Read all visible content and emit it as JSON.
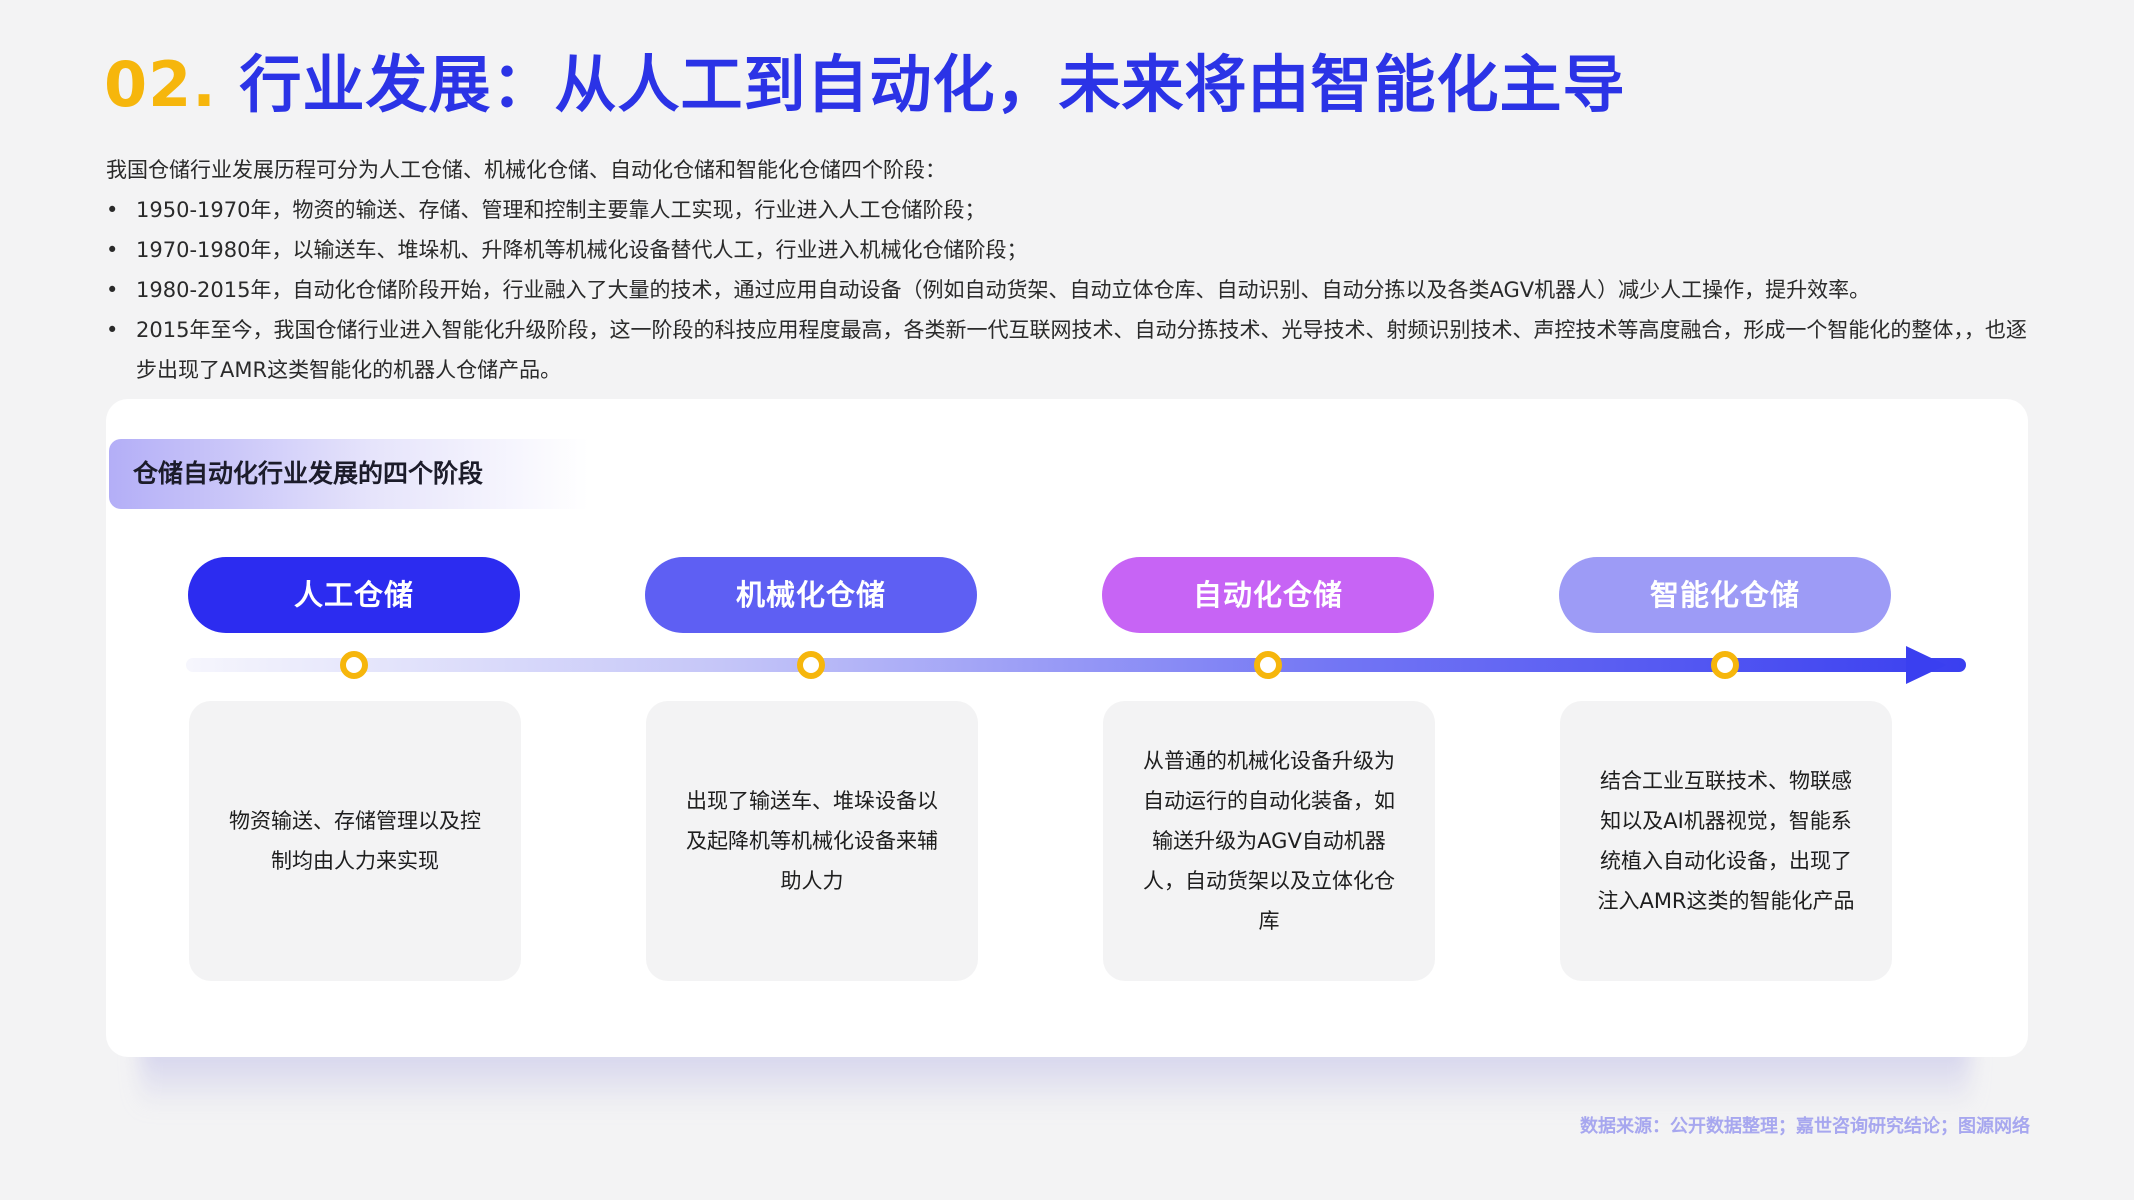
{
  "title": {
    "number": "02.",
    "text": "行业发展：从人工到自动化，未来将由智能化主导"
  },
  "intro": {
    "lead": "我国仓储行业发展历程可分为人工仓储、机械化仓储、自动化仓储和智能化仓储四个阶段：",
    "bullets": [
      "1950-1970年，物资的输送、存储、管理和控制主要靠人工实现，行业进入人工仓储阶段；",
      "1970-1980年，以输送车、堆垛机、升降机等机械化设备替代人工，行业进入机械化仓储阶段；",
      "1980-2015年，自动化仓储阶段开始，行业融入了大量的技术，通过应用自动设备（例如自动货架、自动立体仓库、自动识别、自动分拣以及各类AGV机器人）减少人工操作，提升效率。",
      "2015年至今，我国仓储行业进入智能化升级阶段，这一阶段的科技应用程度最高，各类新一代互联网技术、自动分拣技术、光导技术、射频识别技术、声控技术等高度融合，形成一个智能化的整体，，也逐步出现了AMR这类智能化的机器人仓储产品。"
    ]
  },
  "panel": {
    "tag": "仓储自动化行业发展的四个阶段",
    "stages": [
      {
        "label": "人工仓储",
        "color": "#2c2cf0",
        "desc": "物资输送、存储管理以及控制均由人力来实现"
      },
      {
        "label": "机械化仓储",
        "color": "#5e5ff3",
        "desc": "出现了输送车、堆垛设备以及起降机等机械化设备来辅助人力"
      },
      {
        "label": "自动化仓储",
        "color": "#c764f5",
        "desc": "从普通的机械化设备升级为自动运行的自动化装备，如输送升级为AGV自动机器人，自动货架以及立体化仓库"
      },
      {
        "label": "智能化仓储",
        "color": "#9d9bf6",
        "desc": "结合工业互联技术、物联感知以及AI机器视觉，智能系统植入自动化设备，出现了注入AMR这类的智能化产品"
      }
    ]
  },
  "source": "数据来源：公开数据整理；嘉世咨询研究结论；图源网络"
}
